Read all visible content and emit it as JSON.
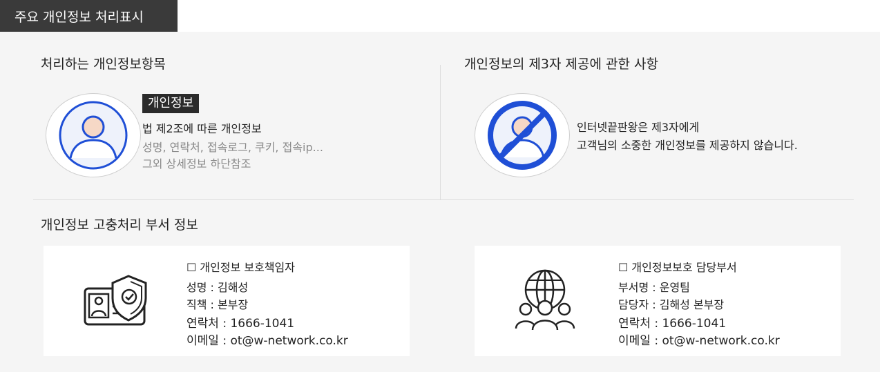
{
  "header": {
    "title": "주요 개인정보 처리표시"
  },
  "items_section": {
    "title": "처리하는 개인정보항목",
    "badge": "개인정보",
    "line1": "법 제2조에 따른 개인정보",
    "line2": "성명, 연락처, 접속로그, 쿠키, 접속ip...",
    "line3": "그외 상세정보 하단참조"
  },
  "third_party_section": {
    "title": "개인정보의 제3자 제공에 관한 사항",
    "line1": "인터넷끝판왕은 제3자에게",
    "line2": "고객님의 소중한 개인정보를 제공하지 않습니다."
  },
  "dept_section": {
    "title": "개인정보 고충처리 부서 정보",
    "officer": {
      "heading": "☐ 개인정보 보호책임자",
      "name": "성명 : 김해성",
      "position": "직책 :  본부장",
      "contact": "연락처 : 1666-1041",
      "email": "이메일 : ot@w-network.co.kr"
    },
    "department": {
      "heading": "☐ 개인정보보호 담당부서",
      "dept": "부서명 : 운영팀",
      "manager": "담당자 : 김해성 본부장",
      "contact": "연락처 : 1666-1041",
      "email": "이메일 :  ot@w-network.co.kr"
    }
  },
  "colors": {
    "accent_blue": "#1f4fd6",
    "dark": "#2b2b2b",
    "panel_bg": "#f5f5f5"
  }
}
